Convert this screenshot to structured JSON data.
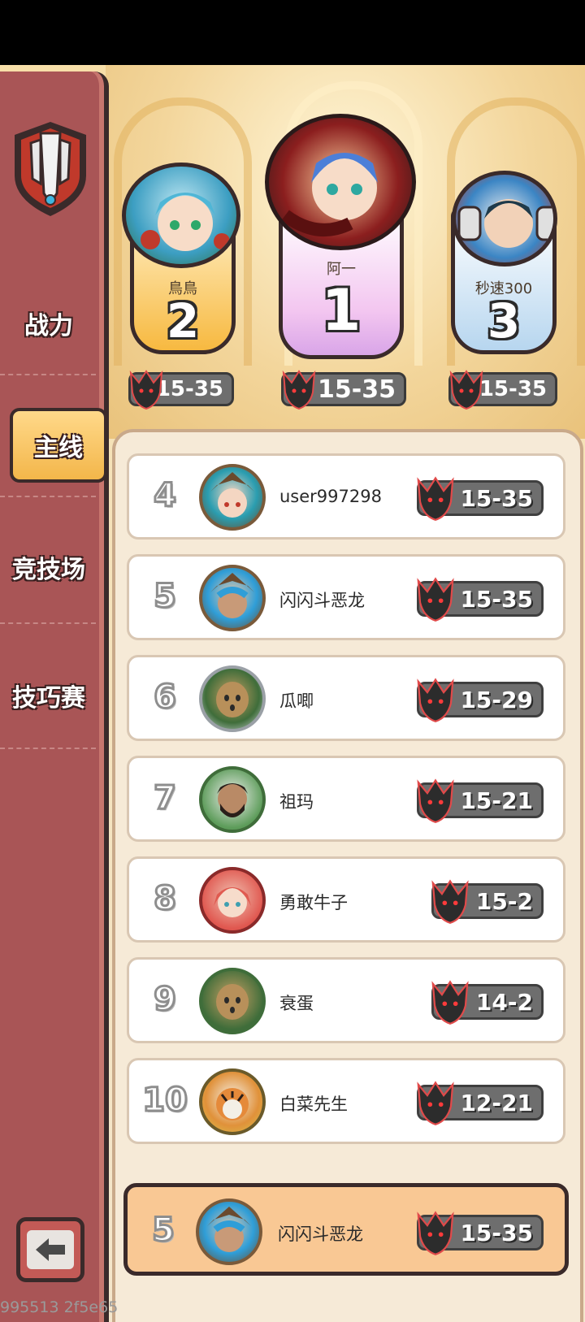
{
  "sidebar": {
    "items": [
      {
        "label": "战力"
      },
      {
        "label": "主线"
      },
      {
        "label": "竞技场"
      },
      {
        "label": "技巧赛"
      }
    ],
    "active_index": 1
  },
  "podium": {
    "first": {
      "rank": "1",
      "name": "阿一",
      "score": "15-35"
    },
    "second": {
      "rank": "2",
      "name": "鳥鳥",
      "score": "15-35"
    },
    "third": {
      "rank": "3",
      "name": "秒速300",
      "score": "15-35"
    }
  },
  "list": [
    {
      "rank": "4",
      "name": "user997298",
      "score": "15-35"
    },
    {
      "rank": "5",
      "name": "闪闪斗恶龙",
      "score": "15-35"
    },
    {
      "rank": "6",
      "name": "瓜唧",
      "score": "15-29"
    },
    {
      "rank": "7",
      "name": "祖玛",
      "score": "15-21"
    },
    {
      "rank": "8",
      "name": "勇敢牛子",
      "score": "15-2"
    },
    {
      "rank": "9",
      "name": "衰蛋",
      "score": "14-2"
    },
    {
      "rank": "10",
      "name": "白菜先生",
      "score": "12-21"
    }
  ],
  "me": {
    "rank": "5",
    "name": "闪闪斗恶龙",
    "score": "15-35"
  },
  "watermark": "995513 2f5e65",
  "colors": {
    "sidebar": "#a95556",
    "active_tab": "#f3b64a",
    "my_row": "#f9c894",
    "score_pill": "#6e6e6e"
  }
}
